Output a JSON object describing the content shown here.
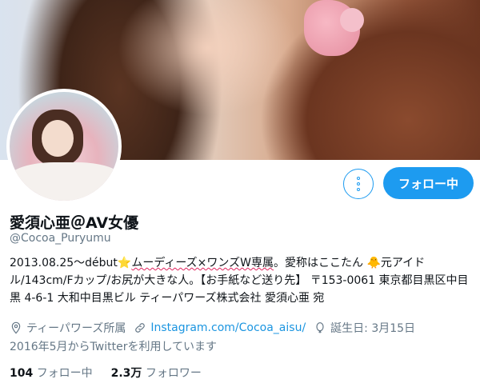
{
  "profile": {
    "name": "愛須心亜＠AV女優",
    "handle": "@Cocoa_Puryumu",
    "follow_button": "フォロー中"
  },
  "bio": {
    "seg1": "2013.08.25～début",
    "star_emoji": "⭐",
    "seg2": "ムーディーズ×ワンズW専属",
    "seg3": "。愛称はここたん ",
    "chick_emoji": "🐥",
    "seg4": "元アイドル/143cm/Fカップ/お尻が大きな人。【お手紙など送り先】 〒153-0061 東京都目黒区中目黒 4-6-1 大和中目黒ビル ティーパワーズ株式会社 愛須心亜 宛"
  },
  "meta": {
    "location": "ティーパワーズ所属",
    "website": "Instagram.com/Cocoa_aisu/",
    "birthday": "誕生日: 3月15日",
    "joined": "2016年5月からTwitterを利用しています"
  },
  "stats": {
    "following_count": "104",
    "following_label": "フォロー中",
    "followers_count": "2.3万",
    "followers_label": "フォロワー"
  },
  "icons": [
    "location-icon",
    "link-icon",
    "balloon-icon",
    "calendar-icon",
    "more-icon"
  ],
  "colors": {
    "accent": "#1d9bf0",
    "muted": "#657786",
    "link": "#1b95e0"
  }
}
